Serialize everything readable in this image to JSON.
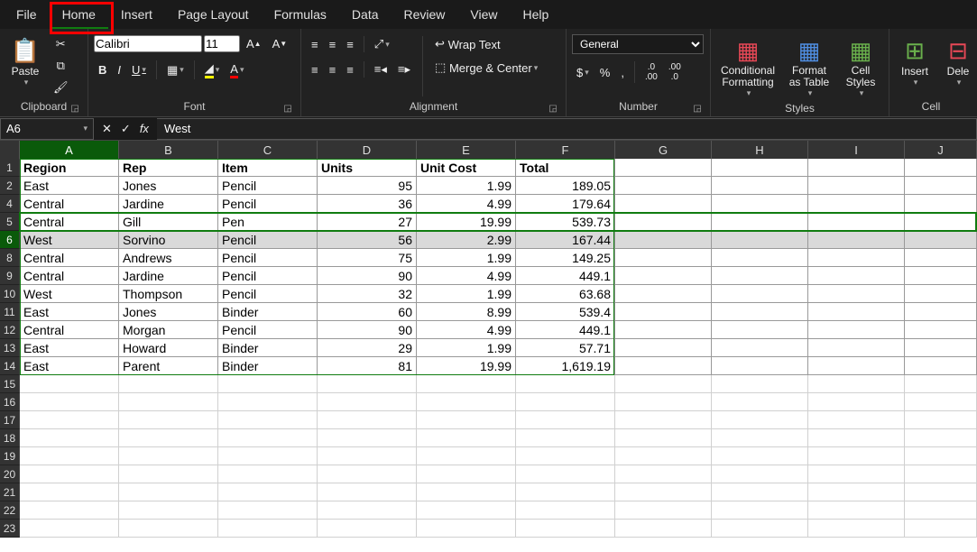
{
  "tabs": [
    "File",
    "Home",
    "Insert",
    "Page Layout",
    "Formulas",
    "Data",
    "Review",
    "View",
    "Help"
  ],
  "active_tab": "Home",
  "clipboard": {
    "paste": "Paste",
    "label": "Clipboard"
  },
  "font": {
    "name": "Calibri",
    "size": "11",
    "bold": "B",
    "italic": "I",
    "underline": "U",
    "label": "Font"
  },
  "alignment": {
    "wrap": "Wrap Text",
    "merge": "Merge & Center",
    "label": "Alignment"
  },
  "number": {
    "format": "General",
    "acct": "$",
    "percent": "%",
    "comma": ",",
    "inc": ".0→.00",
    "dec": ".00→.0",
    "label": "Number"
  },
  "styles": {
    "cond": "Conditional Formatting",
    "fmt": "Format as Table",
    "cell": "Cell Styles",
    "label": "Styles"
  },
  "cells": {
    "insert": "Insert",
    "delete": "Dele",
    "label": "Cell"
  },
  "namebox": "A6",
  "formula": "West",
  "columns": [
    "A",
    "B",
    "C",
    "D",
    "E",
    "F",
    "G",
    "H",
    "I",
    "J"
  ],
  "row_headers": [
    1,
    2,
    4,
    5,
    6,
    8,
    9,
    10,
    11,
    12,
    13,
    14,
    15,
    16,
    17,
    18,
    19,
    20,
    21,
    22,
    23
  ],
  "header_row": [
    "Region",
    "Rep",
    "Item",
    "Units",
    "Unit Cost",
    "Total"
  ],
  "data": [
    {
      "n": 2,
      "r": "East",
      "p": "Jones",
      "i": "Pencil",
      "u": "95",
      "c": "1.99",
      "t": "189.05"
    },
    {
      "n": 4,
      "r": "Central",
      "p": "Jardine",
      "i": "Pencil",
      "u": "36",
      "c": "4.99",
      "t": "179.64"
    },
    {
      "n": 5,
      "r": "Central",
      "p": "Gill",
      "i": "Pen",
      "u": "27",
      "c": "19.99",
      "t": "539.73"
    },
    {
      "n": 6,
      "r": "West",
      "p": "Sorvino",
      "i": "Pencil",
      "u": "56",
      "c": "2.99",
      "t": "167.44"
    },
    {
      "n": 8,
      "r": "Central",
      "p": "Andrews",
      "i": "Pencil",
      "u": "75",
      "c": "1.99",
      "t": "149.25"
    },
    {
      "n": 9,
      "r": "Central",
      "p": "Jardine",
      "i": "Pencil",
      "u": "90",
      "c": "4.99",
      "t": "449.1"
    },
    {
      "n": 10,
      "r": "West",
      "p": "Thompson",
      "i": "Pencil",
      "u": "32",
      "c": "1.99",
      "t": "63.68"
    },
    {
      "n": 11,
      "r": "East",
      "p": "Jones",
      "i": "Binder",
      "u": "60",
      "c": "8.99",
      "t": "539.4"
    },
    {
      "n": 12,
      "r": "Central",
      "p": "Morgan",
      "i": "Pencil",
      "u": "90",
      "c": "4.99",
      "t": "449.1"
    },
    {
      "n": 13,
      "r": "East",
      "p": "Howard",
      "i": "Binder",
      "u": "29",
      "c": "1.99",
      "t": "57.71"
    },
    {
      "n": 14,
      "r": "East",
      "p": "Parent",
      "i": "Binder",
      "u": "81",
      "c": "19.99",
      "t": "1,619.19"
    }
  ],
  "selected_row": 6
}
